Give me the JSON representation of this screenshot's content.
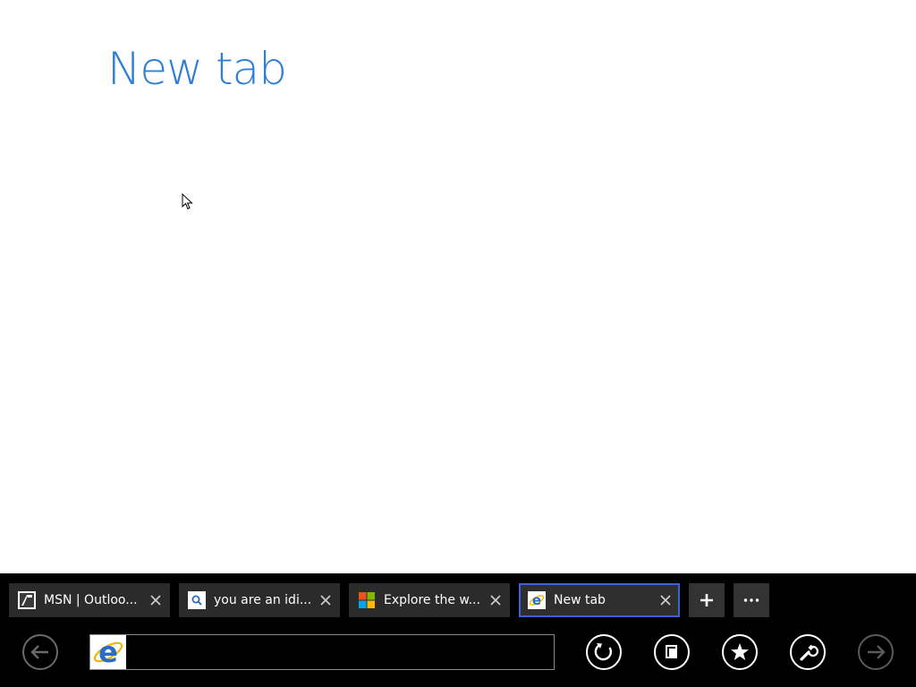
{
  "page": {
    "title": "New tab"
  },
  "tabs": [
    {
      "label": "MSN | Outloo...",
      "icon": "msn-outlook-icon",
      "active": false
    },
    {
      "label": "you are an idi...",
      "icon": "search-icon",
      "active": false
    },
    {
      "label": "Explore the w...",
      "icon": "microsoft-logo-icon",
      "active": false
    },
    {
      "label": "New tab",
      "icon": "ie-icon",
      "active": true
    }
  ],
  "tab_actions": {
    "new_tab_icon": "plus-icon",
    "tab_tools_icon": "ellipsis-icon"
  },
  "address_bar": {
    "value": "",
    "placeholder": "",
    "site_icon": "ie-logo-icon"
  },
  "nav_buttons": {
    "back_icon": "back-arrow-icon",
    "refresh_icon": "refresh-icon",
    "pin_icon": "pin-site-icon",
    "favorites_icon": "favorites-star-icon",
    "tools_icon": "wrench-icon",
    "forward_icon": "forward-arrow-icon"
  },
  "colors": {
    "title": "#2f7fd8",
    "appbar": "#000000",
    "tab": "#2b2b2b",
    "active_tab_border": "#3e62d6"
  }
}
